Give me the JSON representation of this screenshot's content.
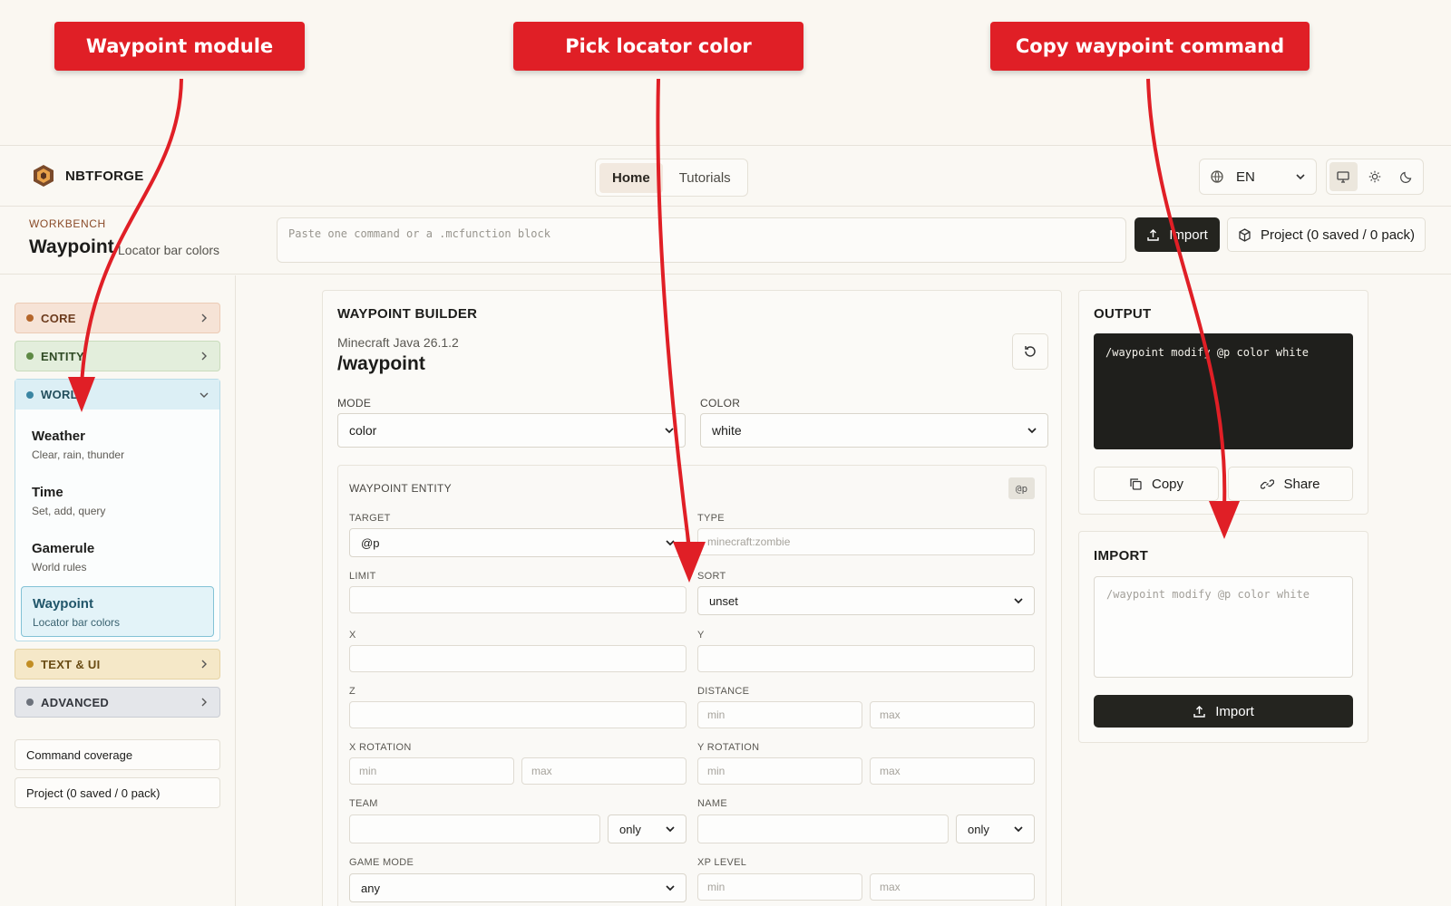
{
  "callouts": [
    "Waypoint module",
    "Pick locator color",
    "Copy waypoint command"
  ],
  "header": {
    "logo_text": "NBTFORGE",
    "nav": [
      "Home",
      "Tutorials"
    ],
    "language": "EN"
  },
  "workbench": {
    "kicker": "WORKBENCH",
    "title": "Waypoint",
    "subtitle": "Locator bar colors",
    "paste_placeholder": "Paste one command or a .mcfunction block",
    "import_label": "Import",
    "project_label": "Project (0 saved / 0 pack)"
  },
  "sidebar": {
    "categories": {
      "core": "CORE",
      "entity": "ENTITY",
      "world": "WORLD",
      "text_ui": "TEXT & UI",
      "advanced": "ADVANCED"
    },
    "world_items": [
      {
        "title": "Weather",
        "sub": "Clear, rain, thunder"
      },
      {
        "title": "Time",
        "sub": "Set, add, query"
      },
      {
        "title": "Gamerule",
        "sub": "World rules"
      },
      {
        "title": "Waypoint",
        "sub": "Locator bar colors"
      }
    ],
    "coverage_label": "Command coverage",
    "project_label": "Project (0 saved / 0 pack)"
  },
  "builder": {
    "title": "WAYPOINT BUILDER",
    "version": "Minecraft Java 26.1.2",
    "command": "/waypoint",
    "mode_label": "MODE",
    "mode_value": "color",
    "color_label": "COLOR",
    "color_value": "white",
    "entity": {
      "title": "WAYPOINT ENTITY",
      "badge": "@p",
      "target_label": "TARGET",
      "target_value": "@p",
      "type_label": "TYPE",
      "type_placeholder": "minecraft:zombie",
      "limit_label": "LIMIT",
      "sort_label": "SORT",
      "sort_value": "unset",
      "x_label": "X",
      "y_label": "Y",
      "z_label": "Z",
      "distance_label": "DISTANCE",
      "x_rotation_label": "X ROTATION",
      "y_rotation_label": "Y ROTATION",
      "team_label": "TEAM",
      "team_mode": "only",
      "name_label": "NAME",
      "name_mode": "only",
      "game_mode_label": "GAME MODE",
      "game_mode_value": "any",
      "xp_level_label": "XP LEVEL",
      "min_placeholder": "min",
      "max_placeholder": "max"
    }
  },
  "output": {
    "title": "OUTPUT",
    "command": "/waypoint modify @p color white",
    "copy_label": "Copy",
    "share_label": "Share"
  },
  "import_panel": {
    "title": "IMPORT",
    "placeholder": "/waypoint modify @p color white",
    "button_label": "Import"
  },
  "colors": {
    "callout": "#e01f26",
    "core": "#f6e3d6",
    "entity": "#e3eedc",
    "world": "#dceff5",
    "text_ui": "#f5e8c8",
    "advanced": "#e4e6ea",
    "dark": "#24241f"
  }
}
